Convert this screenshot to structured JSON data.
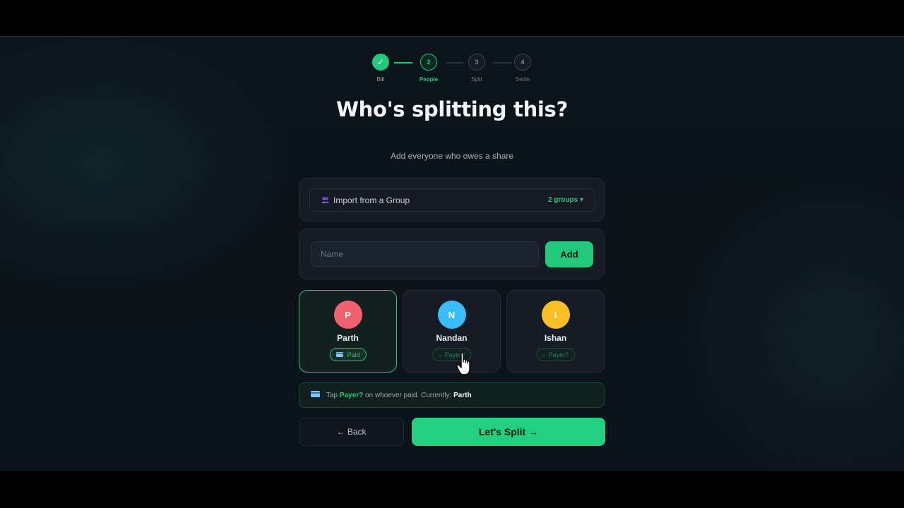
{
  "stepper": {
    "steps": [
      {
        "label": "Bill",
        "marker": "✓",
        "state": "done"
      },
      {
        "label": "People",
        "marker": "2",
        "state": "active"
      },
      {
        "label": "Split",
        "marker": "3",
        "state": "todo"
      },
      {
        "label": "Settle",
        "marker": "4",
        "state": "todo"
      }
    ]
  },
  "header": {
    "title": "Who's splitting this?",
    "subtitle": "Add everyone who owes a share"
  },
  "import_group": {
    "icon": "users-icon",
    "label": "Import from a Group",
    "count": "2 groups ▾"
  },
  "add_person": {
    "placeholder": "Name",
    "value": "",
    "button_label": "Add"
  },
  "people": [
    {
      "initial": "P",
      "name": "Parth",
      "color": "#f0606f",
      "badge": "Paid",
      "badge_icon": "card-icon",
      "is_payer": true
    },
    {
      "initial": "N",
      "name": "Nandan",
      "color": "#38bdf8",
      "badge": "Payer?",
      "badge_icon": "circle-icon",
      "is_payer": false
    },
    {
      "initial": "I",
      "name": "Ishan",
      "color": "#fbbf24",
      "badge": "Payer?",
      "badge_icon": "circle-icon",
      "is_payer": false
    }
  ],
  "hint": {
    "icon": "card-icon",
    "prefix": "Tap",
    "highlight": "Payer?",
    "middle": "on whoever paid. Currently:",
    "current_payer": "Parth"
  },
  "actions": {
    "back_label": "← Back",
    "next_label": "Let's Split →"
  },
  "colors": {
    "accent": "#22c97a",
    "background": "#0b131a",
    "card": "#151c25"
  }
}
